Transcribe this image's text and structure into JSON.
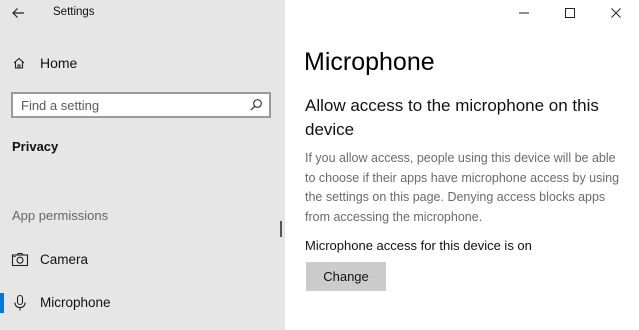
{
  "window": {
    "title": "Settings",
    "controls": [
      "minimize-icon",
      "maximize-icon",
      "close-icon"
    ]
  },
  "sidebar": {
    "home_label": "Home",
    "search": {
      "placeholder": "Find a setting",
      "value": ""
    },
    "section_title": "Privacy",
    "group_label": "App permissions",
    "items": [
      {
        "label": "Camera",
        "icon": "camera-icon",
        "selected": false
      },
      {
        "label": "Microphone",
        "icon": "microphone-icon",
        "selected": true
      }
    ]
  },
  "main": {
    "page_title": "Microphone",
    "heading": "Allow access to the microphone on this device",
    "description": "If you allow access, people using this device will be able to choose if their apps have microphone access by using the settings on this page. Denying access blocks apps from accessing the microphone.",
    "status": "Microphone access for this device is on",
    "change_button": "Change"
  },
  "colors": {
    "sidebar_bg": "#e6e6e6",
    "accent": "#0078d7",
    "button_bg": "#cccccc"
  }
}
